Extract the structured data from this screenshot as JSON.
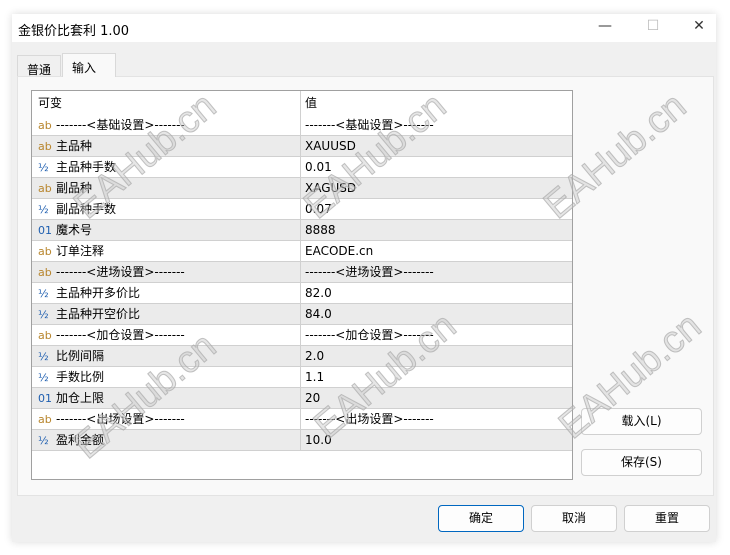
{
  "window": {
    "title": "金银价比套利 1.00",
    "minimize": "—",
    "maximize": "☐",
    "close": "✕"
  },
  "tabs": [
    {
      "label": "普通"
    },
    {
      "label": "输入"
    }
  ],
  "table": {
    "headers": [
      "可变",
      "值"
    ],
    "rows": [
      {
        "type": "ab",
        "name": "-------<基础设置>-------",
        "value": "-------<基础设置>-------"
      },
      {
        "type": "ab",
        "name": "主品种",
        "value": "XAUUSD"
      },
      {
        "type": "½",
        "name": "主品种手数",
        "value": "0.01"
      },
      {
        "type": "ab",
        "name": "副品种",
        "value": "XAGUSD"
      },
      {
        "type": "½",
        "name": "副品种手数",
        "value": "0.07"
      },
      {
        "type": "01",
        "name": "魔术号",
        "value": "8888"
      },
      {
        "type": "ab",
        "name": "订单注释",
        "value": "EACODE.cn"
      },
      {
        "type": "ab",
        "name": "-------<进场设置>-------",
        "value": "-------<进场设置>-------"
      },
      {
        "type": "½",
        "name": "主品种开多价比",
        "value": "82.0"
      },
      {
        "type": "½",
        "name": "主品种开空价比",
        "value": "84.0"
      },
      {
        "type": "ab",
        "name": "-------<加仓设置>-------",
        "value": "-------<加仓设置>-------"
      },
      {
        "type": "½",
        "name": "比例间隔",
        "value": "2.0"
      },
      {
        "type": "½",
        "name": "手数比例",
        "value": "1.1"
      },
      {
        "type": "01",
        "name": "加仓上限",
        "value": "20"
      },
      {
        "type": "ab",
        "name": "-------<出场设置>-------",
        "value": "-------<出场设置>-------"
      },
      {
        "type": "½",
        "name": "盈利金额",
        "value": "10.0"
      }
    ]
  },
  "side_buttons": {
    "load": "载入(L)",
    "save": "保存(S)"
  },
  "footer_buttons": {
    "ok": "确定",
    "cancel": "取消",
    "reset": "重置"
  },
  "watermark": "EAHub.cn"
}
